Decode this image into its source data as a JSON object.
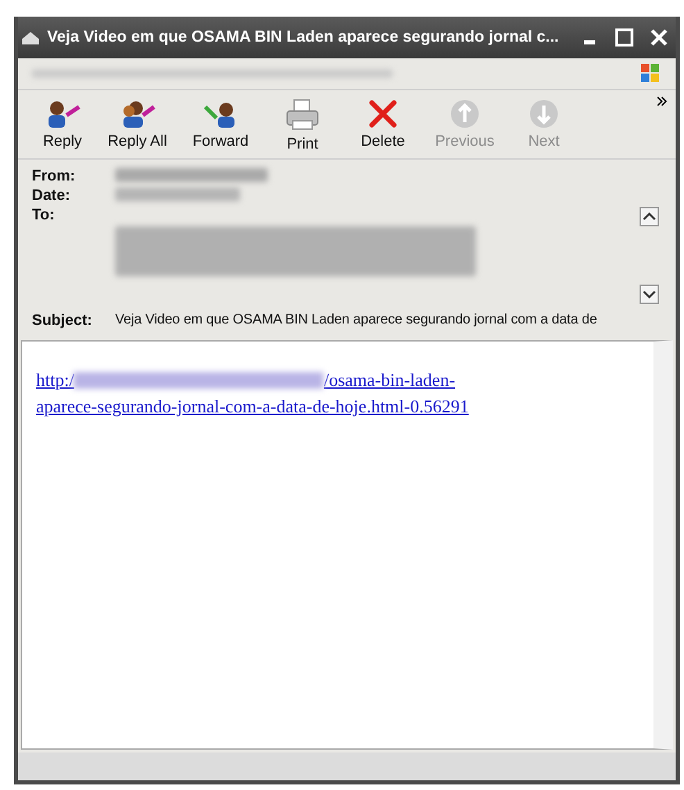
{
  "window": {
    "title": "Veja Video em que OSAMA BIN Laden aparece segurando jornal c..."
  },
  "toolbar": [
    {
      "label": "Reply",
      "kind": "reply",
      "disabled": false
    },
    {
      "label": "Reply All",
      "kind": "replyall",
      "disabled": false
    },
    {
      "label": "Forward",
      "kind": "forward",
      "disabled": false
    },
    {
      "label": "Print",
      "kind": "print",
      "disabled": false
    },
    {
      "label": "Delete",
      "kind": "delete",
      "disabled": false
    },
    {
      "label": "Previous",
      "kind": "up",
      "disabled": true
    },
    {
      "label": "Next",
      "kind": "down",
      "disabled": true
    }
  ],
  "header": {
    "from_label": "From:",
    "date_label": "Date:",
    "to_label": "To:",
    "subject_label": "Subject:",
    "subject": "Veja Video em que OSAMA BIN Laden aparece segurando jornal com a data de"
  },
  "body": {
    "link_start": "http:/",
    "link_middle": "/osama-bin-laden-",
    "link_end": "aparece-segurando-jornal-com-a-data-de-hoje.html-0.56291"
  }
}
